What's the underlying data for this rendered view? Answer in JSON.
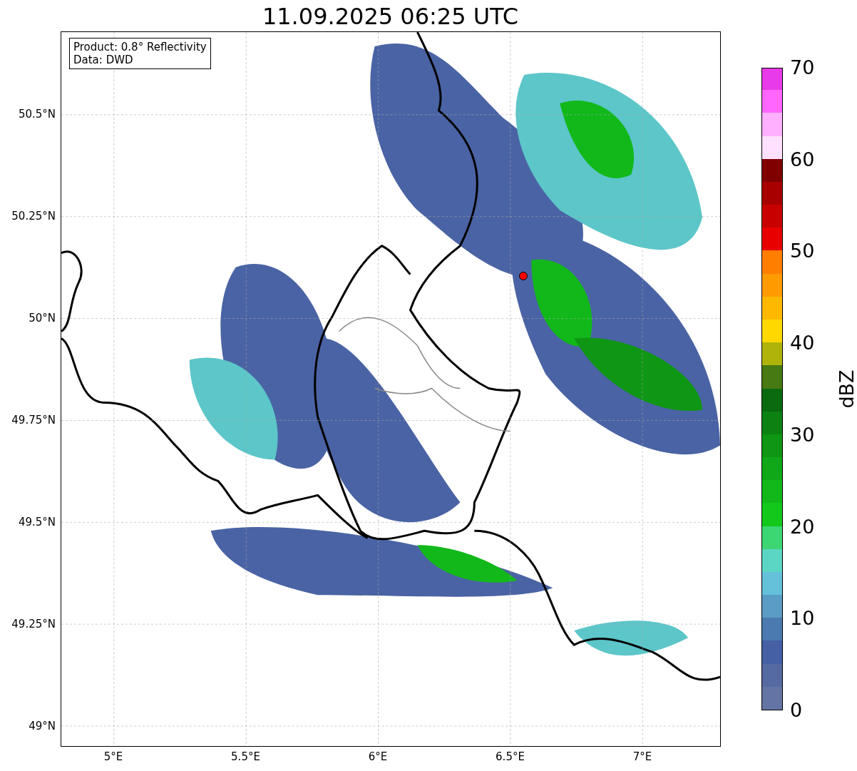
{
  "title": "11.09.2025 06:25 UTC",
  "info": [
    "Product: 0.8° Reflectivity",
    "Data: DWD"
  ],
  "lat_ticks": [
    "50.5°N",
    "50.25°N",
    "50°N",
    "49.75°N",
    "49.5°N",
    "49.25°N",
    "49°N"
  ],
  "lon_ticks": [
    "5°E",
    "5.5°E",
    "6°E",
    "6.5°E",
    "7°E"
  ],
  "colorbar": {
    "label": "dBZ",
    "ticks": [
      "70",
      "60",
      "50",
      "40",
      "30",
      "20",
      "10",
      "0"
    ]
  }
}
